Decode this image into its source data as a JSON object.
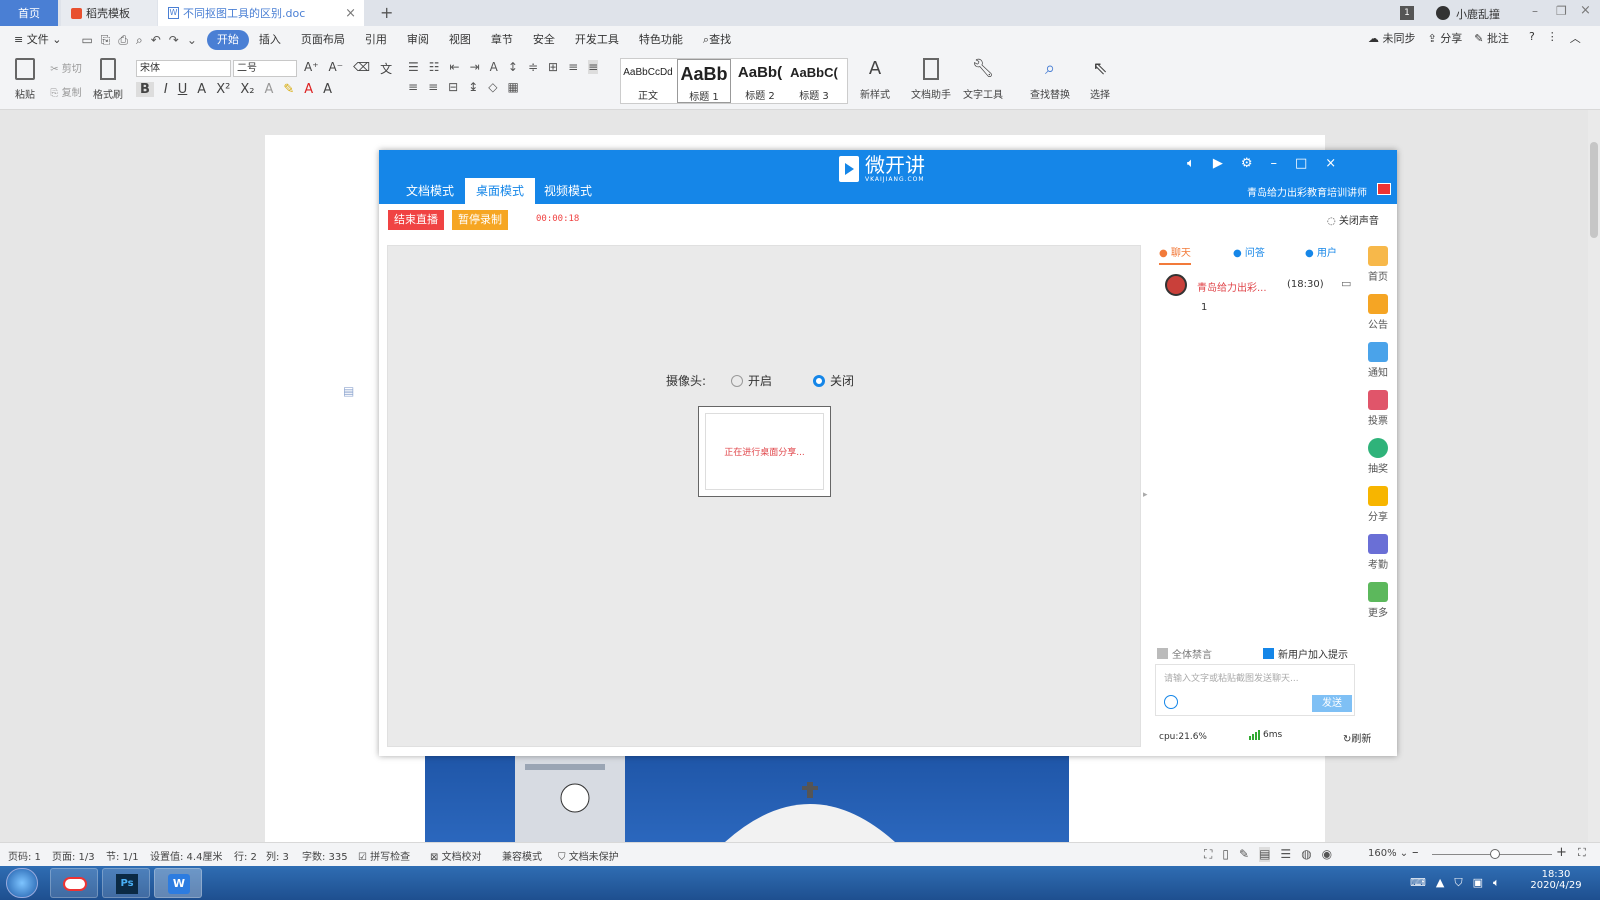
{
  "titlebar": {
    "tabs": [
      {
        "label": "首页"
      },
      {
        "label": "稻壳模板"
      },
      {
        "label": "不同抠图工具的区别.doc"
      }
    ],
    "badge": "1",
    "user": "小鹿乱撞"
  },
  "menubar": {
    "file": "文件",
    "items": [
      "开始",
      "插入",
      "页面布局",
      "引用",
      "审阅",
      "视图",
      "章节",
      "安全",
      "开发工具",
      "特色功能"
    ],
    "search": "查找",
    "right": [
      "未同步",
      "分享",
      "批注"
    ]
  },
  "ribbon": {
    "paste": "粘贴",
    "cut": "剪切",
    "copy": "复制",
    "format_painter": "格式刷",
    "font_name": "宋体",
    "font_size": "二号",
    "styles": [
      {
        "preview": "AaBbCcDd",
        "name": "正文"
      },
      {
        "preview": "AaBb",
        "name": "标题 1"
      },
      {
        "preview": "AaBb(",
        "name": "标题 2"
      },
      {
        "preview": "AaBbC(",
        "name": "标题 3"
      }
    ],
    "new_style": "新样式",
    "doc_assistant": "文档助手",
    "text_tools": "文字工具",
    "find_replace": "查找替换",
    "select": "选择"
  },
  "app": {
    "logo": "微开讲",
    "logo_sub": "VKAIJIANG.COM",
    "account": "青岛给力出彩教育培训讲师",
    "modes": [
      "文档模式",
      "桌面模式",
      "视频模式"
    ],
    "active_mode": "桌面模式",
    "end_live": "结束直播",
    "pause_record": "暂停录制",
    "timer": "00:00:18",
    "mute": "关闭声音",
    "camera_label": "摄像头:",
    "camera_on": "开启",
    "camera_off": "关闭",
    "sharing": "正在进行桌面分享...",
    "chat_tabs": [
      "聊天",
      "问答",
      "用户"
    ],
    "message": {
      "sender": "青岛给力出彩...",
      "time": "(18:30)",
      "text": "1"
    },
    "mute_all": "全体禁言",
    "new_user_hint": "新用户加入提示",
    "input_placeholder": "请输入文字或粘贴截图发送聊天...",
    "send": "发送",
    "cpu": "cpu:21.6%",
    "latency": "6ms",
    "refresh": "刷新",
    "side_menu": [
      "首页",
      "公告",
      "通知",
      "投票",
      "抽奖",
      "分享",
      "考勤",
      "更多"
    ],
    "colors": {
      "primary": "#1586e8",
      "end": "#f04343",
      "pause": "#f6a623"
    }
  },
  "statusbar": {
    "page_no": "页码: 1",
    "pages": "页面: 1/3",
    "section": "节: 1/1",
    "setting": "设置值: 4.4厘米",
    "row": "行: 2",
    "col": "列: 3",
    "words": "字数: 335",
    "spellcheck": "拼写检查",
    "doc_check": "文档校对",
    "compat": "兼容模式",
    "protect": "文档未保护",
    "zoom": "160%"
  },
  "taskbar": {
    "time": "18:30",
    "date": "2020/4/29"
  }
}
